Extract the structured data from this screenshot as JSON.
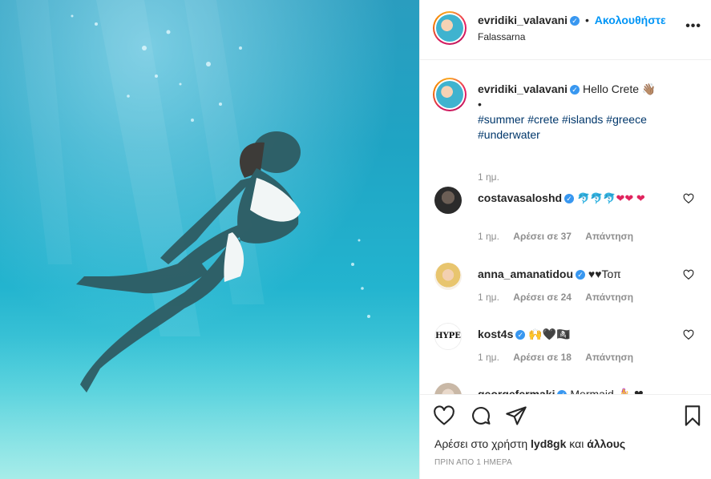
{
  "post": {
    "image_alt": "Woman swimming underwater in a white bikini"
  },
  "header": {
    "username": "evridiki_valavani",
    "dot": "•",
    "follow_label": "Ακολουθήστε",
    "location": "Falassarna",
    "more_label": "•••"
  },
  "caption": {
    "username": "evridiki_valavani",
    "text": "Hello Crete 👋🏽",
    "bullet": "•",
    "hashtags": "#summer #crete #islands #greece #underwater",
    "time": "1 ημ."
  },
  "comments": [
    {
      "username": "costavasaloshd",
      "text": "🐬🐬🐬❤❤ ❤",
      "time": "1 ημ.",
      "likes": "Αρέσει σε 37",
      "reply": "Απάντηση",
      "avatar": "dark-portrait"
    },
    {
      "username": "anna_amanatidou",
      "text": "♥♥Τοπ",
      "time": "1 ημ.",
      "likes": "Αρέσει σε 24",
      "reply": "Απάντηση",
      "avatar": "blonde-portrait"
    },
    {
      "username": "kost4s",
      "text": "🙌🖤🏴‍☠️",
      "time": "1 ημ.",
      "likes": "Αρέσει σε 18",
      "reply": "Απάντηση",
      "avatar": "hype-logo",
      "avatar_text": "HYPE"
    },
    {
      "username": "georgefermaki",
      "text": "Mermaid 🧜‍♀️ ❤",
      "avatar": "light-portrait"
    }
  ],
  "footer": {
    "liked_prefix": "Αρέσει στο χρήστη",
    "liked_user": "lyd8gk",
    "liked_and": "και",
    "liked_others": "άλλους",
    "timestamp": "ΠΡΙΝ ΑΠΟ 1 ΗΜΕΡΑ"
  },
  "colors": {
    "accent": "#0095f6",
    "verified": "#3897f0",
    "heart": "#e0245e",
    "muted": "#8e8e8e"
  },
  "icons": [
    "heart-icon",
    "comment-icon",
    "share-icon",
    "bookmark-icon",
    "verified-icon",
    "more-icon"
  ]
}
